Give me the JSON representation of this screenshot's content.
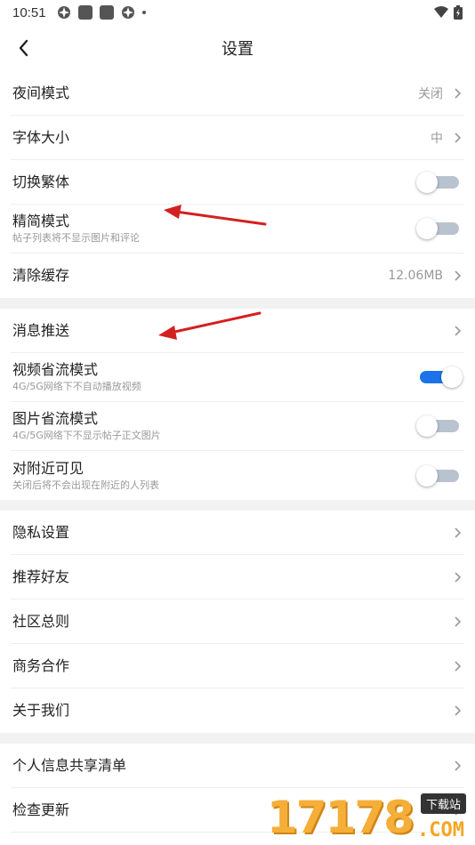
{
  "status_bar": {
    "time": "10:51"
  },
  "header": {
    "title": "设置"
  },
  "sections": [
    [
      {
        "label": "夜间模式",
        "value": "关闭",
        "type": "link"
      },
      {
        "label": "字体大小",
        "value": "中",
        "type": "link"
      },
      {
        "label": "切换繁体",
        "type": "toggle",
        "on": false
      },
      {
        "label": "精简模式",
        "sub": "帖子列表将不显示图片和评论",
        "type": "toggle",
        "on": false
      },
      {
        "label": "清除缓存",
        "value": "12.06MB",
        "type": "link"
      }
    ],
    [
      {
        "label": "消息推送",
        "type": "link"
      },
      {
        "label": "视频省流模式",
        "sub": "4G/5G网络下不自动播放视频",
        "type": "toggle",
        "on": true
      },
      {
        "label": "图片省流模式",
        "sub": "4G/5G网络下不显示帖子正文图片",
        "type": "toggle",
        "on": false
      },
      {
        "label": "对附近可见",
        "sub": "关闭后将不会出现在附近的人列表",
        "type": "toggle",
        "on": false
      }
    ],
    [
      {
        "label": "隐私设置",
        "type": "link"
      },
      {
        "label": "推荐好友",
        "type": "link"
      },
      {
        "label": "社区总则",
        "type": "link"
      },
      {
        "label": "商务合作",
        "type": "link"
      },
      {
        "label": "关于我们",
        "type": "link"
      }
    ],
    [
      {
        "label": "个人信息共享清单",
        "type": "link"
      },
      {
        "label": "检查更新",
        "type": "link"
      }
    ]
  ],
  "colors": {
    "accent": "#1a73e8",
    "annotation_arrow": "#d42020",
    "watermark": "#f5a623"
  },
  "watermark": {
    "digits": "17178",
    "badge": "下载站",
    "suffix": ".COM"
  }
}
